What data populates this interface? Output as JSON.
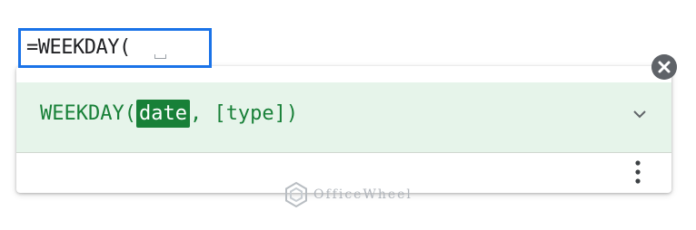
{
  "cell_editor": {
    "formula_text": "=WEEKDAY("
  },
  "formula_help": {
    "function_name": "WEEKDAY(",
    "active_argument": "date",
    "rest_of_signature": ", [type])",
    "expand_icon": "chevron-down-icon",
    "more_icon": "more-vert-icon",
    "close_icon": "close-icon"
  },
  "colors": {
    "accent_green": "#188038",
    "row_highlight": "#e6f4ea",
    "selection_blue": "#1a73e8"
  },
  "watermark": {
    "text": "OfficeWheel"
  }
}
